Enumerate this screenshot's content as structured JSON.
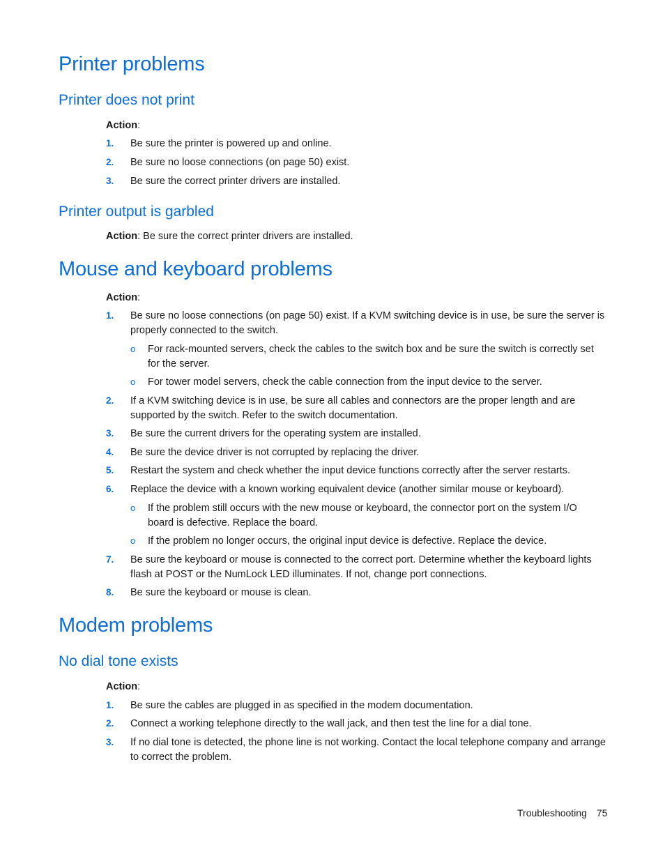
{
  "sections": {
    "printer": {
      "title": "Printer problems",
      "does_not_print": {
        "title": "Printer does not print",
        "action_label": "Action",
        "items": [
          {
            "num": "1.",
            "text": "Be sure the printer is powered up and online."
          },
          {
            "num": "2.",
            "text": "Be sure no loose connections (on page 50) exist."
          },
          {
            "num": "3.",
            "text": "Be sure the correct printer drivers are installed."
          }
        ]
      },
      "garbled": {
        "title": "Printer output is garbled",
        "action_label": "Action",
        "action_text": ": Be sure the correct printer drivers are installed."
      }
    },
    "mouse_keyboard": {
      "title": "Mouse and keyboard problems",
      "action_label": "Action",
      "items": [
        {
          "num": "1.",
          "text": "Be sure no loose connections (on page 50) exist. If a KVM switching device is in use, be sure the server is properly connected to the switch.",
          "subitems": [
            "For rack-mounted servers, check the cables to the switch box and be sure the switch is correctly set for the server.",
            "For tower model servers, check the cable connection from the input device to the server."
          ]
        },
        {
          "num": "2.",
          "text": "If a KVM switching device is in use, be sure all cables and connectors are the proper length and are supported by the switch. Refer to the switch documentation."
        },
        {
          "num": "3.",
          "text": "Be sure the current drivers for the operating system are installed."
        },
        {
          "num": "4.",
          "text": "Be sure the device driver is not corrupted by replacing the driver."
        },
        {
          "num": "5.",
          "text": "Restart the system and check whether the input device functions correctly after the server restarts."
        },
        {
          "num": "6.",
          "text": "Replace the device with a known working equivalent device (another similar mouse or keyboard).",
          "subitems": [
            "If the problem still occurs with the new mouse or keyboard, the connector port on the system I/O board is defective. Replace the board.",
            "If the problem no longer occurs, the original input device is defective. Replace the device."
          ]
        },
        {
          "num": "7.",
          "text": "Be sure the keyboard or mouse is connected to the correct port. Determine whether the keyboard lights flash at POST or the NumLock LED illuminates. If not, change port connections."
        },
        {
          "num": "8.",
          "text": "Be sure the keyboard or mouse is clean."
        }
      ]
    },
    "modem": {
      "title": "Modem problems",
      "no_dial_tone": {
        "title": "No dial tone exists",
        "action_label": "Action",
        "items": [
          {
            "num": "1.",
            "text": "Be sure the cables are plugged in as specified in the modem documentation."
          },
          {
            "num": "2.",
            "text": "Connect a working telephone directly to the wall jack, and then test the line for a dial tone."
          },
          {
            "num": "3.",
            "text": "If no dial tone is detected, the phone line is not working. Contact the local telephone company and arrange to correct the problem."
          }
        ]
      }
    }
  },
  "bullet_glyph": "o",
  "colon": ":",
  "footer": {
    "section": "Troubleshooting",
    "page": "75"
  },
  "colors": {
    "heading": "#0d6dd6",
    "text": "#1a1a1a"
  }
}
